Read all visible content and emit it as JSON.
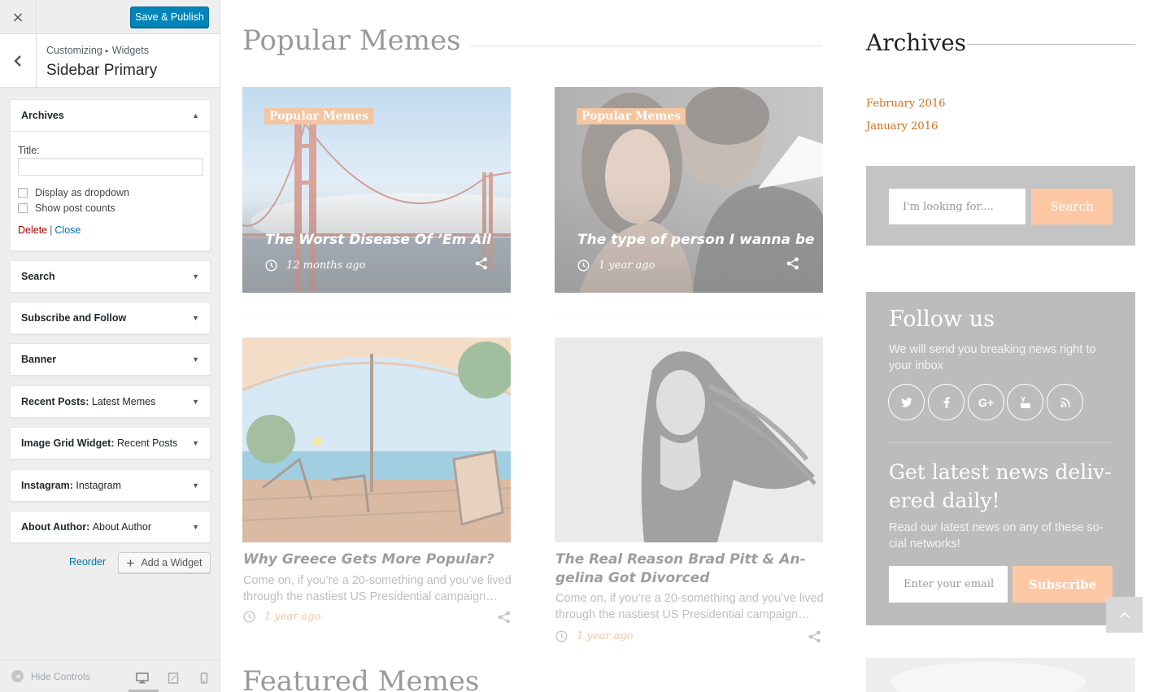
{
  "customizer": {
    "close_label": "×",
    "publish_label": "Save & Publish",
    "breadcrumb": {
      "root": "Customizing",
      "sep": "▸",
      "leaf": "Widgets"
    },
    "section_title": "Sidebar Primary",
    "widgets": [
      {
        "name": "Archives",
        "sub": "",
        "expanded": true
      },
      {
        "name": "Search",
        "sub": ""
      },
      {
        "name": "Subscribe and Follow",
        "sub": ""
      },
      {
        "name": "Banner",
        "sub": ""
      },
      {
        "name": "Recent Posts",
        "sub": "Latest Memes"
      },
      {
        "name": "Image Grid Widget",
        "sub": "Recent Posts"
      },
      {
        "name": "Instagram",
        "sub": "Instagram"
      },
      {
        "name": "About Author",
        "sub": "About Author"
      }
    ],
    "archives_form": {
      "title_label": "Title:",
      "title_value": "",
      "dropdown_label": "Display as dropdown",
      "counts_label": "Show post counts",
      "delete_label": "Delete",
      "pipe": "|",
      "close_label": "Close"
    },
    "reorder_label": "Reorder",
    "add_widget_label": "Add a Widget",
    "hide_controls_label": "Hide Controls",
    "colors": {
      "publish": "#0085ba",
      "link": "#0073aa",
      "delete": "#aa0000"
    }
  },
  "preview": {
    "popular_title": "Popular Memes",
    "featured_title": "Featured Memes",
    "overlay_posts": [
      {
        "tag": "Popular Memes",
        "title": "The Worst Disease Of ’Em All",
        "time": "12 months ago"
      },
      {
        "tag": "Popular Memes",
        "title": "The type of person I wanna be",
        "time": "1 year ago"
      }
    ],
    "posts": [
      {
        "title": "Why Greece Gets More Popular?",
        "excerpt_l1": "Come on, if you’re a 20-something and you’ve lived",
        "excerpt_l2": "through the nastiest US Presidential campaign…",
        "time": "1 year ago"
      },
      {
        "title_l1": "The Real Reason Brad Pitt & An-",
        "title_l2": "gelina Got Divorced",
        "excerpt_l1": "Come on, if you’re a 20-something and you’ve lived",
        "excerpt_l2": "through the nastiest US Presidential campaign…",
        "time": "1 year ago"
      }
    ],
    "sidebar": {
      "archives_title": "Archives",
      "archives": [
        "February 2016",
        "January 2016"
      ],
      "search_placeholder": "I'm looking for....",
      "search_button": "Search",
      "follow_title": "Follow us",
      "follow_text_l1": "We will send you breaking news right to",
      "follow_text_l2": "your inbox",
      "social_icons": [
        "twitter-icon",
        "facebook-icon",
        "google-plus-icon",
        "youtube-icon",
        "rss-icon"
      ],
      "news_title_l1": "Get latest news deliv-",
      "news_title_l2": "ered daily!",
      "news_text_l1": "Read our latest news on any of these so-",
      "news_text_l2": "cial networks!",
      "email_placeholder": "Enter your email",
      "subscribe_button": "Subscribe",
      "google_plus_text": "G+"
    },
    "colors": {
      "accent": "#e5873b",
      "archive_link": "#d26e1c",
      "button": "#ffc8a4",
      "panel": "#bcbcbc"
    }
  }
}
